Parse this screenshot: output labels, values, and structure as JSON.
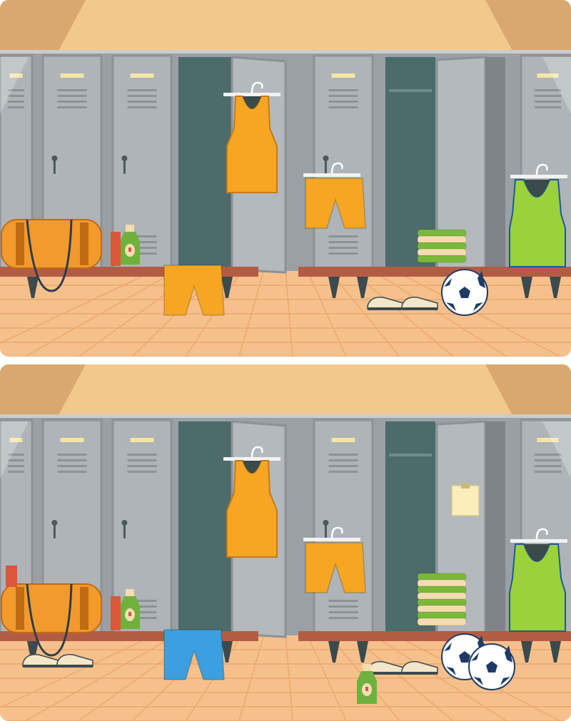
{
  "puzzle": {
    "type": "spot-the-difference",
    "scene": "locker room",
    "panels": [
      {
        "id": "top"
      },
      {
        "id": "bottom"
      }
    ]
  },
  "colors": {
    "ceiling": "#f2c98c",
    "wall_shadow": "#d9a870",
    "locker": "#aeb4b8",
    "locker_dark": "#8c9296",
    "locker_inside": "#4c6b6b",
    "floor": "#f6c08c",
    "bench": "#b35c44",
    "bench_leg": "#3d4a4d",
    "shirt_orange": "#f6a623",
    "shirt_green": "#9bd13a",
    "shorts_blue": "#3b9fe0",
    "bag": "#f29a2e",
    "ball_dark": "#1d3b66",
    "towel_green": "#7ab83a",
    "towel_beige": "#f4dcb0",
    "note": "#fbeebb"
  }
}
